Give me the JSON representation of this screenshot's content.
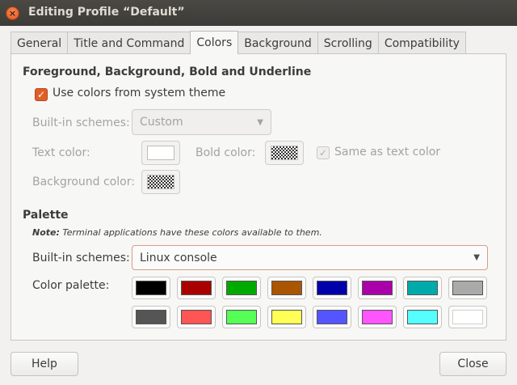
{
  "window": {
    "title": "Editing Profile “Default”",
    "close_glyph": "×"
  },
  "tabs": [
    {
      "label": "General"
    },
    {
      "label": "Title and Command"
    },
    {
      "label": "Colors",
      "active": true
    },
    {
      "label": "Background"
    },
    {
      "label": "Scrolling"
    },
    {
      "label": "Compatibility"
    }
  ],
  "fg_section": {
    "title": "Foreground, Background, Bold and Underline",
    "use_system_label": "Use colors from system theme",
    "use_system_checked": true,
    "builtin_label": "Built-in schemes:",
    "builtin_value": "Custom",
    "text_color_label": "Text color:",
    "bold_color_label": "Bold color:",
    "same_as_text_label": "Same as text color",
    "same_as_text_checked": true,
    "bg_color_label": "Background color:",
    "text_color": "#ffffff"
  },
  "palette_section": {
    "title": "Palette",
    "note_bold": "Note:",
    "note_text": "Terminal applications have these colors available to them.",
    "builtin_label": "Built-in schemes:",
    "builtin_value": "Linux console",
    "palette_label": "Color palette:",
    "colors": [
      "#000000",
      "#aa0000",
      "#00aa00",
      "#aa5500",
      "#0000aa",
      "#aa00aa",
      "#00aaaa",
      "#aaaaaa",
      "#555555",
      "#ff5555",
      "#55ff55",
      "#ffff55",
      "#5555ff",
      "#ff55ff",
      "#55ffff",
      "#ffffff"
    ]
  },
  "footer": {
    "help_label": "Help",
    "close_label": "Close"
  },
  "icons": {
    "check_glyph": "✓",
    "dropdown_glyph": "▼"
  }
}
